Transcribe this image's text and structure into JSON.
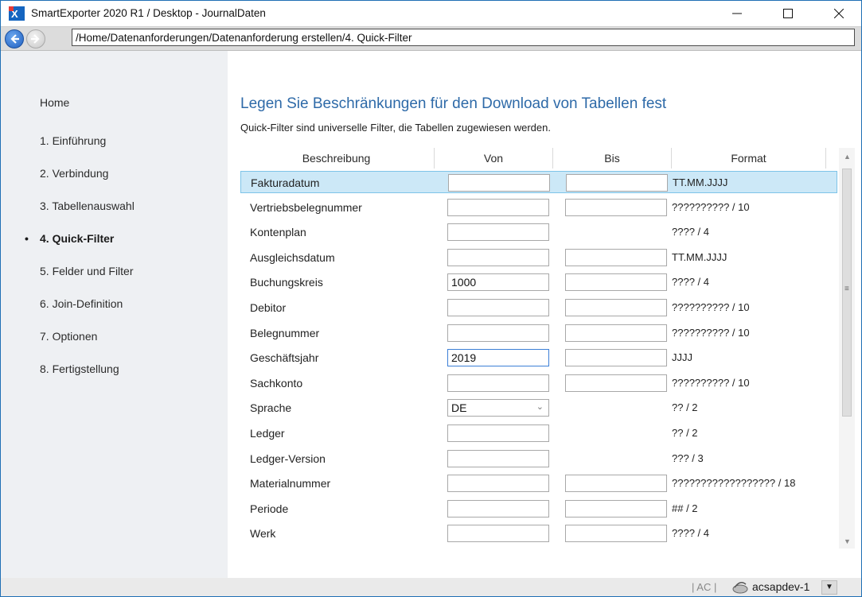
{
  "window": {
    "title": "SmartExporter 2020 R1 / Desktop - JournalDaten"
  },
  "nav": {
    "path": "/Home/Datenanforderungen/Datenanforderung erstellen/4. Quick-Filter"
  },
  "sidebar": {
    "home": "Home",
    "items": [
      {
        "label": "1. Einführung"
      },
      {
        "label": "2. Verbindung"
      },
      {
        "label": "3. Tabellenauswahl"
      },
      {
        "label": "4. Quick-Filter"
      },
      {
        "label": "5. Felder und Filter"
      },
      {
        "label": "6. Join-Definition"
      },
      {
        "label": "7. Optionen"
      },
      {
        "label": "8. Fertigstellung"
      }
    ],
    "active_index": 3
  },
  "main": {
    "heading": "Legen Sie Beschränkungen für den Download von Tabellen fest",
    "subheading": "Quick-Filter sind universelle Filter, die Tabellen zugewiesen werden.",
    "columns": [
      "Beschreibung",
      "Von",
      "Bis",
      "Format"
    ],
    "rows": [
      {
        "label": "Fakturadatum",
        "von": "",
        "bis": "",
        "has_bis": true,
        "format": "TT.MM.JJJJ"
      },
      {
        "label": "Vertriebsbelegnummer",
        "von": "",
        "bis": "",
        "has_bis": true,
        "format": "?????????? / 10"
      },
      {
        "label": "Kontenplan",
        "von": "",
        "bis": "",
        "has_bis": false,
        "format": "???? / 4"
      },
      {
        "label": "Ausgleichsdatum",
        "von": "",
        "bis": "",
        "has_bis": true,
        "format": "TT.MM.JJJJ"
      },
      {
        "label": "Buchungskreis",
        "von": "1000",
        "bis": "",
        "has_bis": true,
        "format": "???? / 4"
      },
      {
        "label": "Debitor",
        "von": "",
        "bis": "",
        "has_bis": true,
        "format": "?????????? / 10"
      },
      {
        "label": "Belegnummer",
        "von": "",
        "bis": "",
        "has_bis": true,
        "format": "?????????? / 10"
      },
      {
        "label": "Geschäftsjahr",
        "von": "2019",
        "bis": "",
        "has_bis": true,
        "format": "JJJJ"
      },
      {
        "label": "Sachkonto",
        "von": "",
        "bis": "",
        "has_bis": true,
        "format": "?????????? / 10"
      },
      {
        "label": "Sprache",
        "von": "DE",
        "bis": "",
        "has_bis": false,
        "format": "?? / 2"
      },
      {
        "label": "Ledger",
        "von": "",
        "bis": "",
        "has_bis": false,
        "format": "?? / 2"
      },
      {
        "label": "Ledger-Version",
        "von": "",
        "bis": "",
        "has_bis": false,
        "format": "??? / 3"
      },
      {
        "label": "Materialnummer",
        "von": "",
        "bis": "",
        "has_bis": true,
        "format": "?????????????????? / 18"
      },
      {
        "label": "Periode",
        "von": "",
        "bis": "",
        "has_bis": true,
        "format": "## / 2"
      },
      {
        "label": "Werk",
        "von": "",
        "bis": "",
        "has_bis": true,
        "format": "???? / 4"
      }
    ]
  },
  "status": {
    "text": "| AC |",
    "system": "acsapdev-1"
  }
}
